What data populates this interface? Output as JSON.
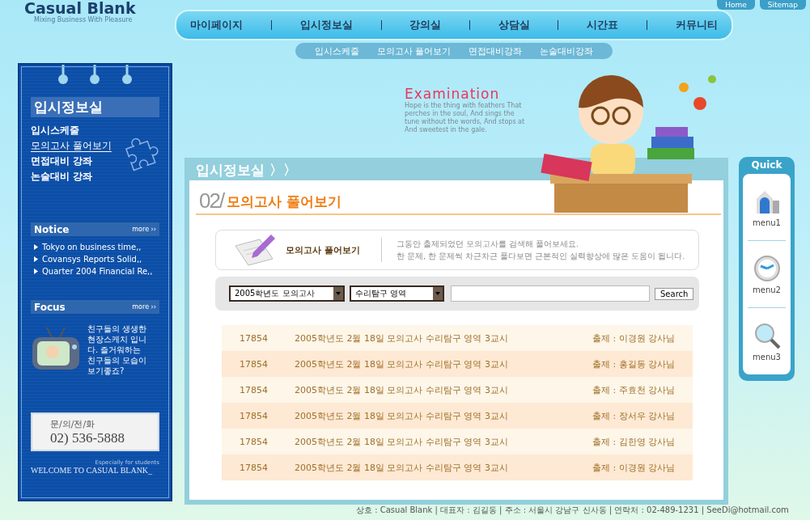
{
  "header": {
    "logo": "Casual Blank",
    "tagline": "Mixing Business With Pleasure",
    "top_links": [
      "Home",
      "Sitemap"
    ],
    "nav": [
      {
        "label": "마이페이지"
      },
      {
        "label": "입시정보실"
      },
      {
        "label": "강의실"
      },
      {
        "label": "상담실"
      },
      {
        "label": "시간표"
      },
      {
        "label": "커뮤니티"
      }
    ],
    "subnav": [
      {
        "label": "입시스케줄"
      },
      {
        "label": "모의고사 풀어보기"
      },
      {
        "label": "면접대비강좌"
      },
      {
        "label": "논술대비강좌"
      }
    ]
  },
  "sidebar": {
    "title": "입시정보실",
    "items": [
      {
        "label": "입시스케줄",
        "selected": false
      },
      {
        "label": "모의고사 풀어보기",
        "selected": true
      },
      {
        "label": "면접대비 강좌",
        "selected": false
      },
      {
        "label": "논술대비 강좌",
        "selected": false
      }
    ],
    "notice": {
      "title": "Notice",
      "more": "more ››",
      "items": [
        "Tokyo on business time,,",
        "Covansys Reports Solid,,",
        "Quarter 2004 Financial Re,,"
      ]
    },
    "focus": {
      "title": "Focus",
      "more": "more ››",
      "text": "친구들의 생생한 현장스케치 입니다. 즐거워하는 친구들의 모습이 보기좋죠?"
    },
    "contact": {
      "label": "문/의/전/화",
      "phone": "02) 536-5888"
    },
    "welcome_small": "Especially for students",
    "welcome": "WELCOME TO CASUAL BLANK_"
  },
  "hero": {
    "title": "Examination",
    "text": "Hope is the thing with feathers That perches in the soul, And sings the tune without the words, And stops at And sweetest in the gale."
  },
  "section": {
    "title": "입시정보실 〉〉",
    "number": "02/",
    "heading": "모의고사 풀어보기",
    "intro": {
      "label": "모의고사 풀어보기",
      "lines": [
        "그동안 출제되었던 모의고사를 검색해 풀어보세요.",
        "한 문제, 한 문제씩 차근차근 풀다보면 근본적인 실력향상에 많은 도움이 됩니다."
      ]
    },
    "search": {
      "year": "2005학년도 모의고사",
      "area": "수리탐구 영역",
      "button": "Search"
    },
    "rows": [
      {
        "no": "17854",
        "title": "2005학년도 2월 18일 모의고사 수리탐구 영역 3교시",
        "author": "출제 : 이경원 강사님"
      },
      {
        "no": "17854",
        "title": "2005학년도 2월 18일 모의고사 수리탐구 영역 3교시",
        "author": "출제 : 홍길동 강사님"
      },
      {
        "no": "17854",
        "title": "2005학년도 2월 18일 모의고사 수리탐구 영역 3교시",
        "author": "출제 : 주효천 강사님"
      },
      {
        "no": "17854",
        "title": "2005학년도 2월 18일 모의고사 수리탐구 영역 3교시",
        "author": "출제 : 장서우 강사님"
      },
      {
        "no": "17854",
        "title": "2005학년도 2월 18일 모의고사 수리탐구 영역 3교시",
        "author": "출제 : 김한영 강사님"
      },
      {
        "no": "17854",
        "title": "2005학년도 2월 18일 모의고사 수리탐구 영역 3교시",
        "author": "출제 : 이경원 강사님"
      }
    ]
  },
  "quick": {
    "title": "Quick",
    "items": [
      {
        "label": "menu1",
        "kind": "building"
      },
      {
        "label": "menu2",
        "kind": "clock"
      },
      {
        "label": "menu3",
        "kind": "magnifier"
      }
    ]
  },
  "footer": "상호 : Casual Blank  |  대표자 : 김길동  |  주소 : 서울시 강남구 신사동  |  연락처 : 02-489-1231  |  SeeDi@hotmail.com"
}
